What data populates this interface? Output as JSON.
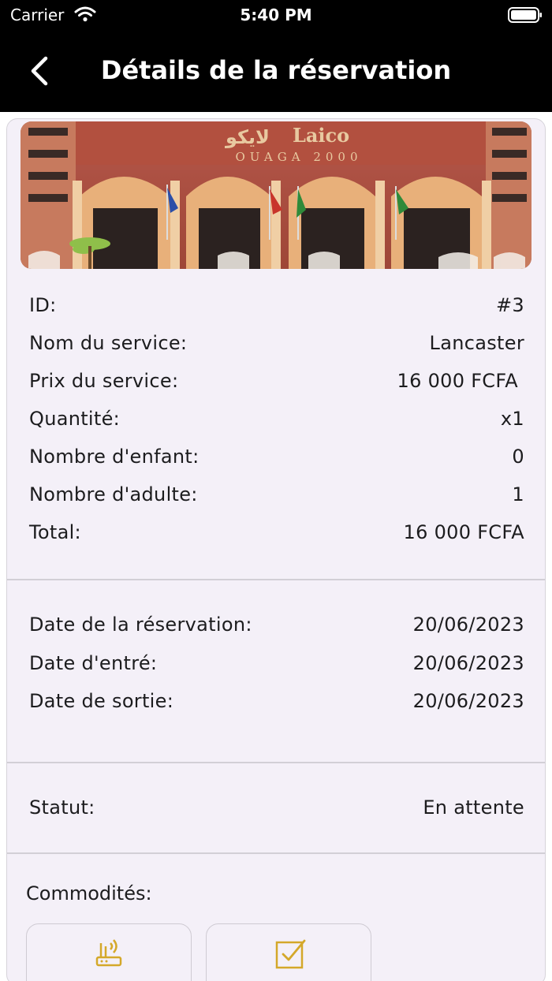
{
  "status_bar": {
    "carrier": "Carrier",
    "time": "5:40 PM"
  },
  "nav": {
    "title": "Détails de la réservation"
  },
  "hero": {
    "sign_latin": "Laico",
    "sign_arabic": "لايكو",
    "sign_sub": "OUAGA 2000"
  },
  "details": [
    {
      "label": "ID:",
      "value": "#3"
    },
    {
      "label": "Nom du service:",
      "value": "Lancaster"
    },
    {
      "label": "Prix du service:",
      "value": "16 000 FCFA"
    },
    {
      "label": "Quantité:",
      "value": "x1"
    },
    {
      "label": "Nombre d'enfant:",
      "value": "0"
    },
    {
      "label": "Nombre d'adulte:",
      "value": "1"
    },
    {
      "label": "Total:",
      "value": "16 000 FCFA"
    }
  ],
  "dates": [
    {
      "label": "Date de la réservation:",
      "value": "20/06/2023"
    },
    {
      "label": "Date d'entré:",
      "value": "20/06/2023"
    },
    {
      "label": "Date de sortie:",
      "value": "20/06/2023"
    }
  ],
  "status": {
    "label": "Statut:",
    "value": "En attente"
  },
  "amenities": {
    "title": "Commodités:",
    "items": [
      {
        "icon": "router-icon"
      },
      {
        "icon": "checkbox-icon"
      }
    ],
    "icon_color": "#d4a82a"
  }
}
